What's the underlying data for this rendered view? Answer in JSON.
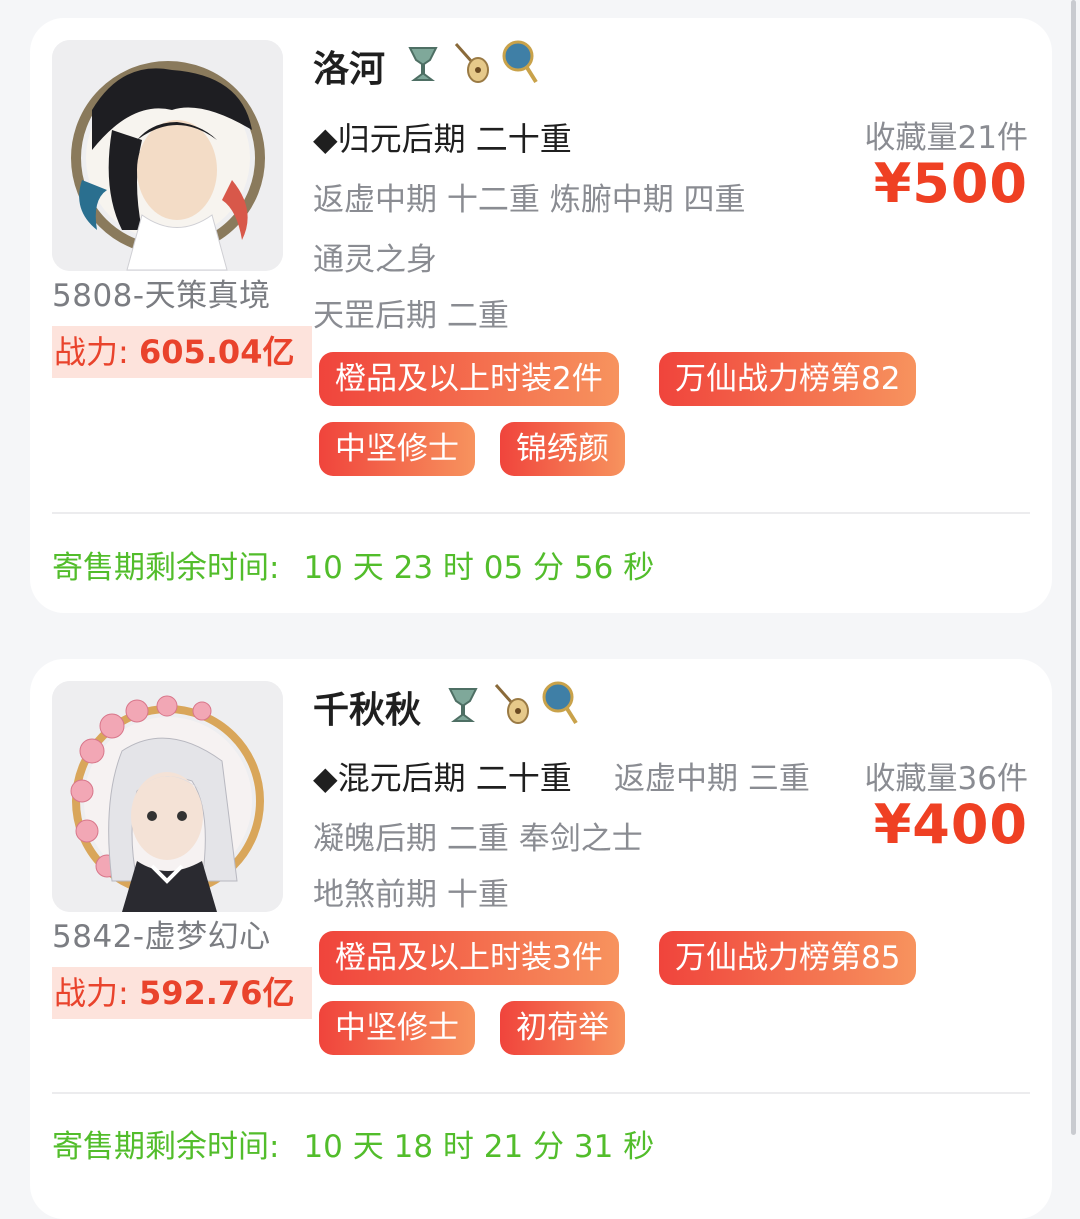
{
  "listings": [
    {
      "name": "洛河",
      "server": "5808-天策真境",
      "power_label": "战力: ",
      "power_value": "605.04亿",
      "realm_main": "◆归元后期 二十重",
      "realm_line2": "返虚中期 十二重 炼腑中期 四重",
      "realm_line3": "通灵之身",
      "realm_line4": "天罡后期 二重",
      "favorites": "收藏量21件",
      "price": "¥500",
      "tags": [
        "橙品及以上时装2件",
        "万仙战力榜第82",
        "中坚修士",
        "锦绣颜"
      ],
      "countdown_label": "寄售期剩余时间:",
      "countdown_value": "10 天 23 时 05 分 56 秒",
      "icons": [
        "bronze-goblet-icon",
        "pipa-lute-icon",
        "round-fan-icon"
      ]
    },
    {
      "name": "千秋秋",
      "server": "5842-虚梦幻心",
      "power_label": "战力: ",
      "power_value": "592.76亿",
      "realm_main": "◆混元后期 二十重",
      "realm_line1b": "返虚中期 三重",
      "realm_line2": "凝魄后期 二重 奉剑之士",
      "realm_line3": "地煞前期 十重",
      "favorites": "收藏量36件",
      "price": "¥400",
      "tags": [
        "橙品及以上时装3件",
        "万仙战力榜第85",
        "中坚修士",
        "初荷举"
      ],
      "countdown_label": "寄售期剩余时间:",
      "countdown_value": "10 天 18 时 21 分 31 秒",
      "icons": [
        "bronze-goblet-icon",
        "pipa-lute-icon",
        "round-fan-icon"
      ]
    }
  ],
  "colors": {
    "price": "#ef4023",
    "countdown": "#52bd2b",
    "tag_start": "#f0443c",
    "tag_end": "#f7935e",
    "power_bg": "#fde3dc"
  }
}
